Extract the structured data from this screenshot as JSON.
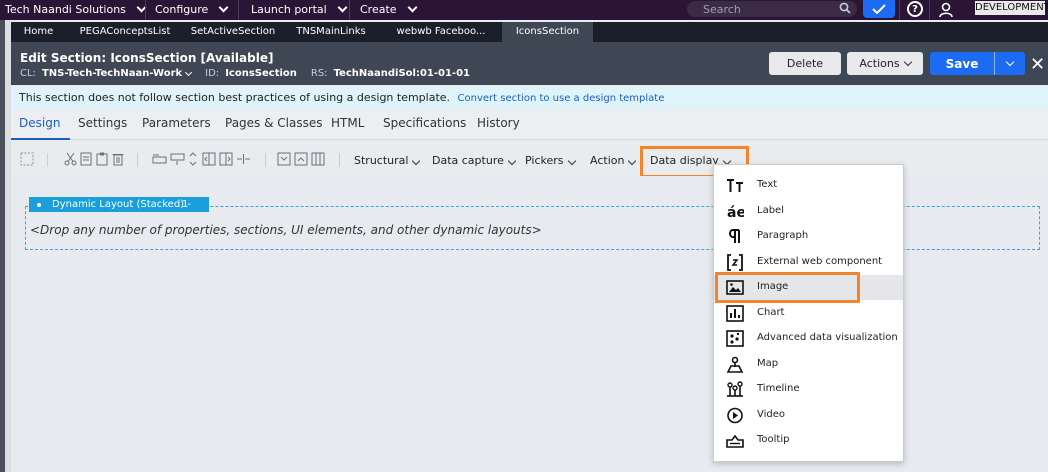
{
  "topnav": {
    "org": "Tech Naandi Solutions",
    "configure": "Configure",
    "launch_portal": "Launch portal",
    "create": "Create",
    "search_placeholder": "Search",
    "environment": "DEVELOPMENT"
  },
  "doc_tabs": [
    "Home",
    "PEGAConceptsList",
    "SetActiveSection",
    "TNSMainLinks",
    "webwb Faceboo...",
    "IconsSection"
  ],
  "header": {
    "title": "Edit  Section: IconsSection [Available]",
    "cl_label": "CL:",
    "cl_value": "TNS-Tech-TechNaan-Work",
    "id_label": "ID:",
    "id_value": "IconsSection",
    "rs_label": "RS:",
    "rs_value": "TechNaandiSol:01-01-01",
    "delete": "Delete",
    "actions": "Actions",
    "save": "Save"
  },
  "banner": {
    "text": "This section does not follow section best practices of using a design template.",
    "link": "Convert section to use a design template"
  },
  "design_tabs": [
    "Design",
    "Settings",
    "Parameters",
    "Pages & Classes",
    "HTML",
    "Specifications",
    "History"
  ],
  "toolbar_menus": [
    "Structural",
    "Data capture",
    "Pickers",
    "Action",
    "Data display"
  ],
  "layout": {
    "label": "Dynamic Layout (Stacked) -",
    "count": "1",
    "placeholder": "<Drop any number of properties, sections, UI elements, and other dynamic layouts>"
  },
  "data_display_menu": [
    {
      "label": "Text",
      "icon": "text-icon"
    },
    {
      "label": "Label",
      "icon": "label-icon"
    },
    {
      "label": "Paragraph",
      "icon": "paragraph-icon"
    },
    {
      "label": "External web component",
      "icon": "external-component-icon"
    },
    {
      "label": "Image",
      "icon": "image-icon"
    },
    {
      "label": "Chart",
      "icon": "chart-icon"
    },
    {
      "label": "Advanced data visualization",
      "icon": "advanced-visualization-icon"
    },
    {
      "label": "Map",
      "icon": "map-icon"
    },
    {
      "label": "Timeline",
      "icon": "timeline-icon"
    },
    {
      "label": "Video",
      "icon": "video-icon"
    },
    {
      "label": "Tooltip",
      "icon": "tooltip-icon"
    }
  ],
  "colors": {
    "topbar": "#2b1536",
    "header": "#3f4654",
    "accent": "#1b6cf2",
    "highlight": "#f2842b",
    "layout_label": "#1a9fda"
  }
}
